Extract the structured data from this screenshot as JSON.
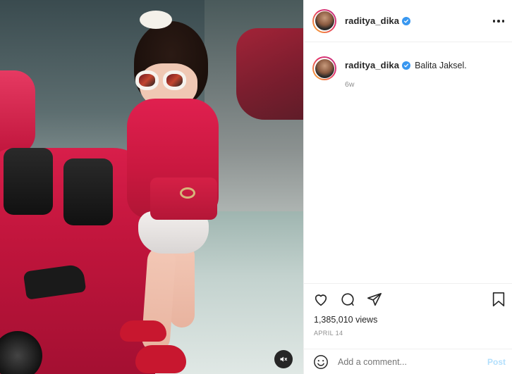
{
  "post": {
    "username": "raditya_dika",
    "verified": true,
    "caption": "Balita Jaksel.",
    "age": "6w",
    "views": "1,385,010 views",
    "date": "APRIL 14"
  },
  "comment": {
    "placeholder": "Add a comment...",
    "post_label": "Post"
  },
  "icons": {
    "like": "heart-icon",
    "comment": "comment-icon",
    "share": "send-icon",
    "save": "bookmark-icon",
    "emoji": "emoji-icon",
    "more": "more-icon",
    "mute": "sound-off-icon"
  },
  "colors": {
    "verified": "#3897f0",
    "muted_text": "#8e8e8e",
    "post_disabled": "#b2dffc"
  }
}
